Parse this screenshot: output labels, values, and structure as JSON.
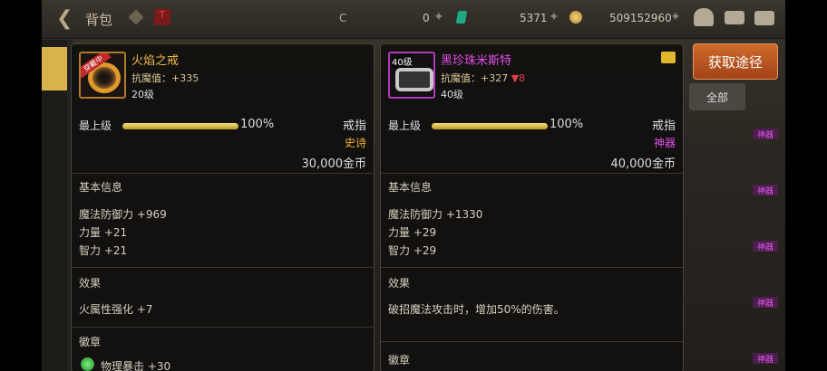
{
  "topbar": {
    "title": "背包",
    "gems": "0",
    "coins_small": "5371",
    "gold": "509152960"
  },
  "obtain_label": "获取途径",
  "all_label": "全部",
  "side_tags": [
    "神器",
    "神器",
    "神器",
    "神器",
    "神器"
  ],
  "left_item": {
    "equipped_tag": "穿戴中",
    "name": "火焰之戒",
    "stat_label": "抗魔值：",
    "stat_value": "+335",
    "level": "20级",
    "grade": "最上级",
    "grade_pct": "100%",
    "grade_fill": 1.0,
    "type": "戒指",
    "rarity": "史诗",
    "price": "30,000金币",
    "basic_title": "基本信息",
    "basic": [
      "魔法防御力 +969",
      "力量 +21",
      "智力 +21"
    ],
    "effect_title": "效果",
    "effect": "火属性强化 +7",
    "emblem_title": "徽章",
    "emblem": "物理暴击 +30",
    "name_color": "#f0b84a",
    "rarity_color": "#f0b030"
  },
  "right_item": {
    "level_tag": "40级",
    "name": "黑珍珠米斯特",
    "stat_label": "抗魔值：",
    "stat_value": "+327",
    "stat_change": "▼8",
    "level": "40级",
    "grade": "最上级",
    "grade_pct": "100%",
    "grade_fill": 1.0,
    "type": "戒指",
    "rarity": "神器",
    "price": "40,000金币",
    "basic_title": "基本信息",
    "basic": [
      "魔法防御力 +1330",
      "力量 +29",
      "智力 +29"
    ],
    "effect_title": "效果",
    "effect": "破招魔法攻击时，增加50%的伤害。",
    "emblem_title": "徽章",
    "name_color": "#e24ee8",
    "rarity_color": "#e24ee8"
  }
}
